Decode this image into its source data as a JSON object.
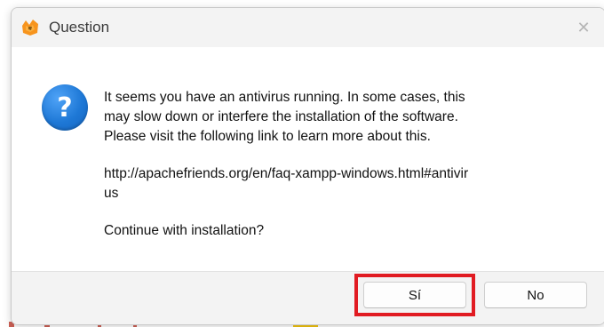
{
  "window": {
    "title": "Question",
    "app_icon": "xampp-icon",
    "close_glyph": "✕"
  },
  "message": {
    "icon": "question-icon",
    "icon_glyph": "?",
    "line1": "It seems you have an antivirus running. In some cases, this",
    "line2": "may slow down or interfere the installation of the software.",
    "line3": "Please visit the following link to learn more about this.",
    "link_line1": "http://apachefriends.org/en/faq-xampp-windows.html#antivir",
    "link_line2": "us",
    "prompt": "Continue with installation?"
  },
  "buttons": {
    "yes_label": "Sí",
    "no_label": "No"
  },
  "colors": {
    "highlight": "#e11b22",
    "icon_blue": "#1e78d6"
  }
}
